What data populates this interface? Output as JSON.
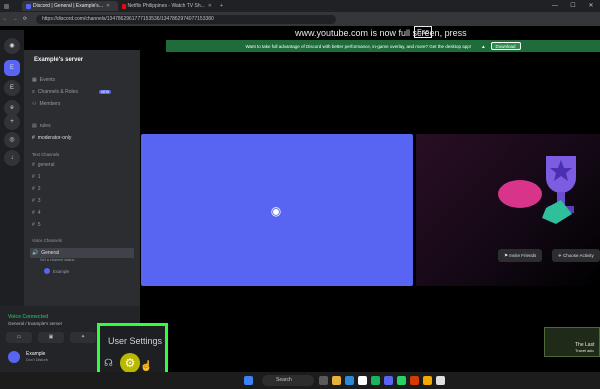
{
  "browser": {
    "tabs": [
      {
        "label": "Discord | General | Example's...",
        "color": "#5865f2",
        "active": true
      },
      {
        "label": "Netflix Philippines - Watch TV Sh...",
        "color": "#e50914",
        "active": false
      }
    ],
    "new_tab": "+",
    "url": "https://discord.com/channels/1347862961777153536/1347862974077153380"
  },
  "fullscreen_notice": {
    "text": "www.youtube.com is now full screen, press",
    "key": "Esc"
  },
  "notice_bar": {
    "text": "Want to take full advantage of Discord with better performance, in-game overlay, and more? Get the desktop app!",
    "button": "Download"
  },
  "server": {
    "name": "Example's server"
  },
  "sidebar": {
    "items": [
      {
        "label": "Events",
        "icon": "calendar-icon"
      },
      {
        "label": "Channels & Roles",
        "icon": "list-icon",
        "badge": "NEW"
      },
      {
        "label": "Members",
        "icon": "members-icon"
      }
    ],
    "channels_top": [
      {
        "label": "rules",
        "bright": false
      },
      {
        "label": "moderator-only",
        "bright": true
      }
    ],
    "text_category": "Text Channels",
    "text_channels": [
      "general",
      "1",
      "2",
      "3",
      "4",
      "5"
    ],
    "voice_category": "Voice Channels",
    "voice_channel": "General",
    "voice_sub": "Set a channel status",
    "voice_user": "Example"
  },
  "voice_panel": {
    "status": "Voice Connected",
    "location": "General / Example's server"
  },
  "user": {
    "name": "Example",
    "status": "Don't Disturb"
  },
  "settings_tooltip": "User Settings",
  "activity": {
    "invite": "Invite Friends",
    "choose": "Choose Activity"
  },
  "mini_card": {
    "line1": "The Last",
    "line2": "Travel ado"
  },
  "taskbar": {
    "search_placeholder": "Search"
  },
  "colors": {
    "blurple": "#5865f2",
    "highlight": "#2fff3c"
  }
}
